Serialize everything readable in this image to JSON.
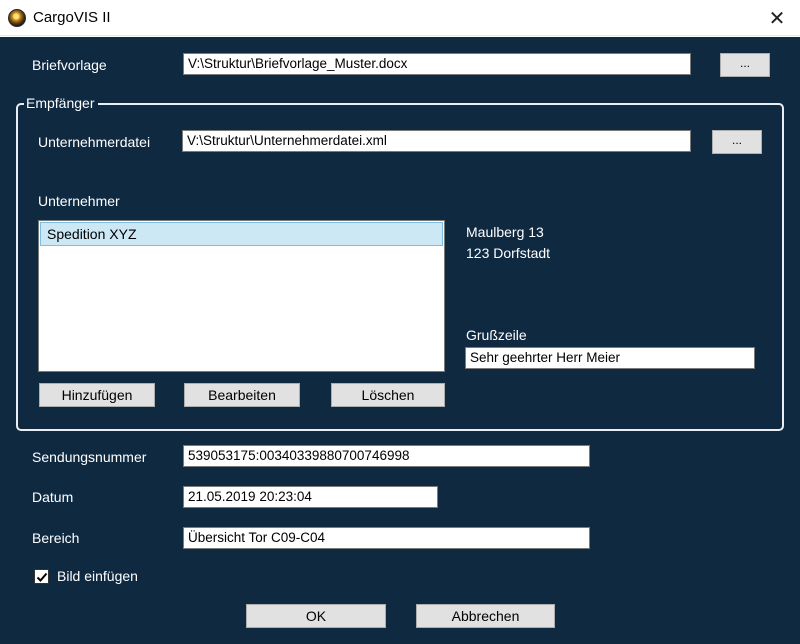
{
  "window": {
    "title": "CargoVIS II",
    "close_glyph": "✕"
  },
  "briefvorlage": {
    "label": "Briefvorlage",
    "value": "V:\\Struktur\\Briefvorlage_Muster.docx",
    "browse_label": "..."
  },
  "empfaenger": {
    "legend": "Empfänger",
    "unternehmerdatei": {
      "label": "Unternehmerdatei",
      "value": "V:\\Struktur\\Unternehmerdatei.xml",
      "browse_label": "..."
    },
    "unternehmer_label": "Unternehmer",
    "unternehmer_items": [
      "Spedition XYZ"
    ],
    "address_lines": [
      "Maulberg 13",
      "123 Dorfstadt"
    ],
    "grusszeile": {
      "label": "Grußzeile",
      "value": "Sehr geehrter Herr Meier"
    },
    "buttons": {
      "add": "Hinzufügen",
      "edit": "Bearbeiten",
      "delete": "Löschen"
    }
  },
  "sendungsnummer": {
    "label": "Sendungsnummer",
    "value": "539053175:00340339880700746998"
  },
  "datum": {
    "label": "Datum",
    "value": "21.05.2019 20:23:04"
  },
  "bereich": {
    "label": "Bereich",
    "value": "Übersicht Tor C09-C04"
  },
  "bild_einfuegen": {
    "label": "Bild einfügen",
    "checked": true
  },
  "footer": {
    "ok": "OK",
    "cancel": "Abbrechen"
  },
  "colors": {
    "background": "#0f2941",
    "selection": "#cce8f4",
    "button_face": "#e1e1e1"
  }
}
